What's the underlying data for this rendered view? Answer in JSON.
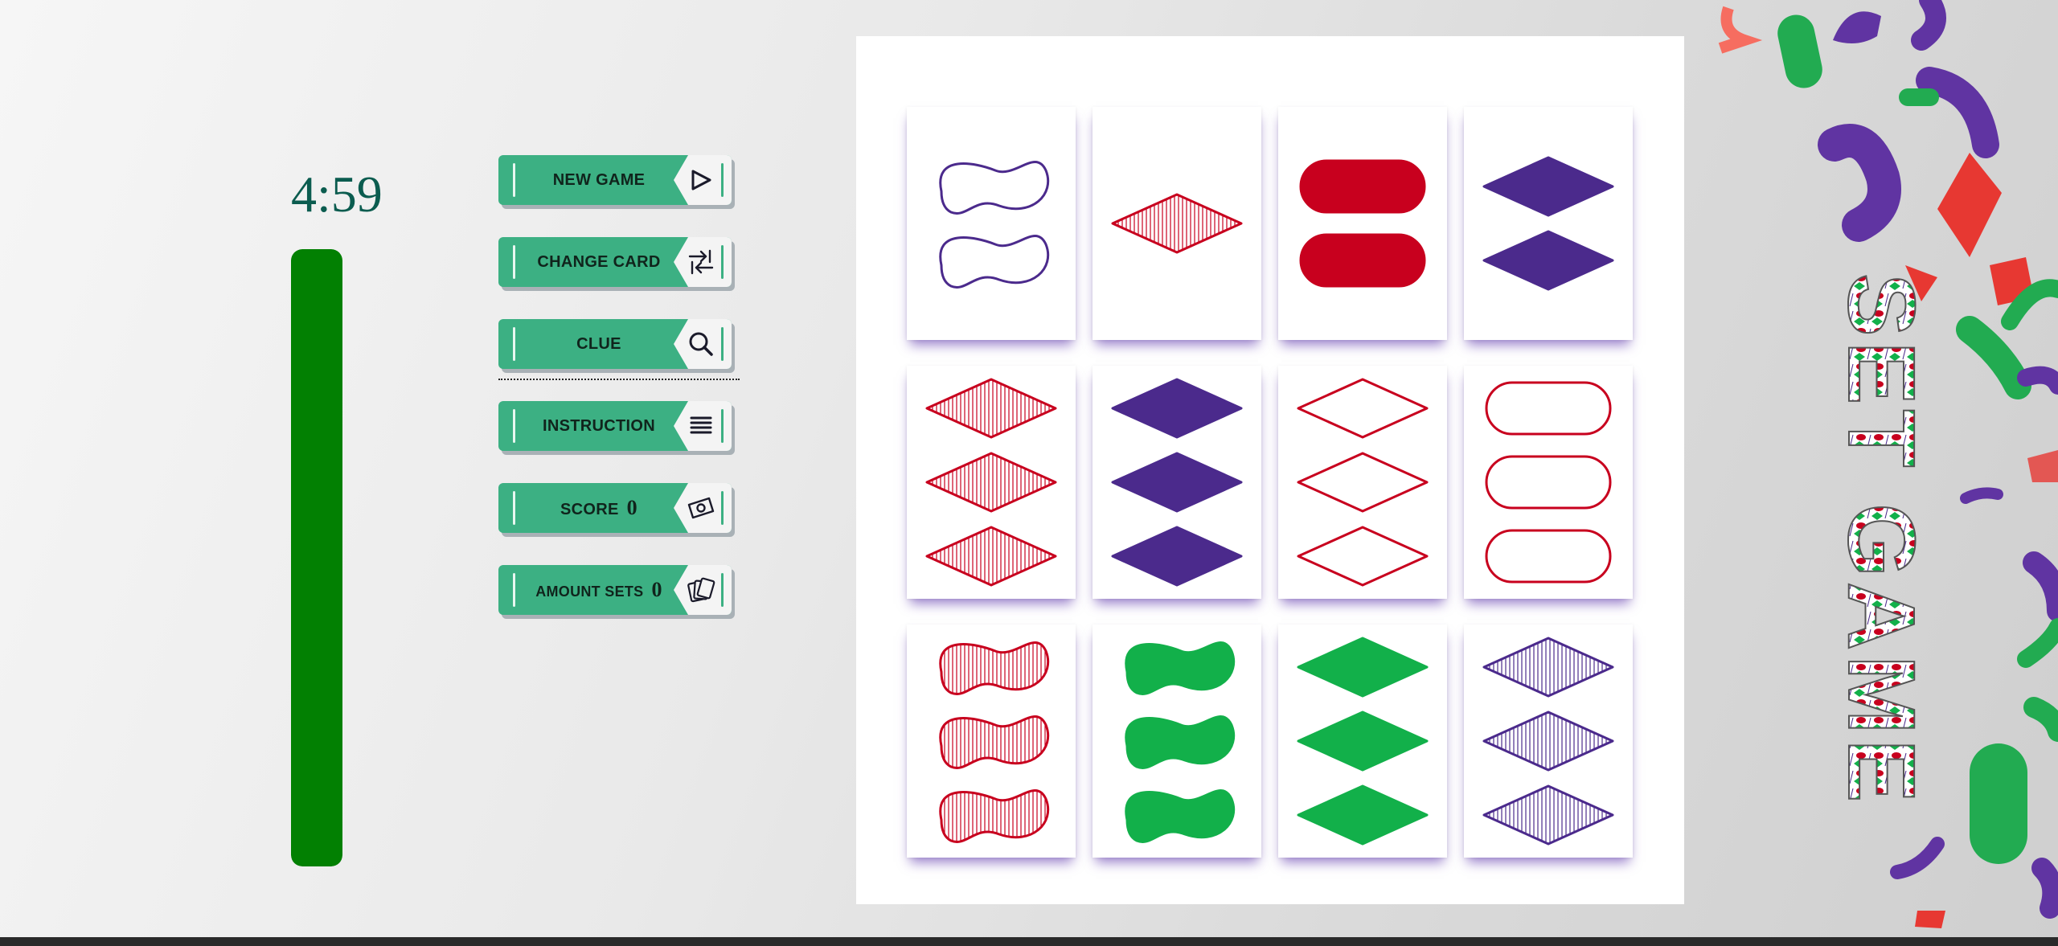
{
  "timer": {
    "text": "4:59",
    "remaining_fraction": 1.0,
    "color": "#028002"
  },
  "menu": {
    "new_game": "NEW GAME",
    "change_card": "CHANGE CARD",
    "clue": "CLUE",
    "instruction": "INSTRUCTION",
    "score_label": "SCORE",
    "score_value": "0",
    "amount_sets_label": "AMOUNT SETS",
    "amount_sets_value": "0"
  },
  "icons": {
    "new_game": "play-icon",
    "change_card": "swap-arrows-icon",
    "clue": "search-icon",
    "instruction": "list-icon",
    "score": "money-icon",
    "amount_sets": "cards-icon"
  },
  "colors": {
    "red": "#c8001e",
    "purple": "#4b2a8c",
    "green": "#12b04a",
    "button": "#3cb083"
  },
  "logo": {
    "text": "SET GAME"
  },
  "cards": [
    {
      "count": 2,
      "shape": "squiggle",
      "color": "purple",
      "shading": "open"
    },
    {
      "count": 1,
      "shape": "diamond",
      "color": "red",
      "shading": "striped"
    },
    {
      "count": 2,
      "shape": "oval",
      "color": "red",
      "shading": "solid"
    },
    {
      "count": 2,
      "shape": "diamond",
      "color": "purple",
      "shading": "solid"
    },
    {
      "count": 3,
      "shape": "diamond",
      "color": "red",
      "shading": "striped"
    },
    {
      "count": 3,
      "shape": "diamond",
      "color": "purple",
      "shading": "solid"
    },
    {
      "count": 3,
      "shape": "diamond",
      "color": "red",
      "shading": "open"
    },
    {
      "count": 3,
      "shape": "oval",
      "color": "red",
      "shading": "open"
    },
    {
      "count": 3,
      "shape": "squiggle",
      "color": "red",
      "shading": "striped"
    },
    {
      "count": 3,
      "shape": "squiggle",
      "color": "green",
      "shading": "solid"
    },
    {
      "count": 3,
      "shape": "diamond",
      "color": "green",
      "shading": "solid"
    },
    {
      "count": 3,
      "shape": "diamond",
      "color": "purple",
      "shading": "striped"
    }
  ]
}
